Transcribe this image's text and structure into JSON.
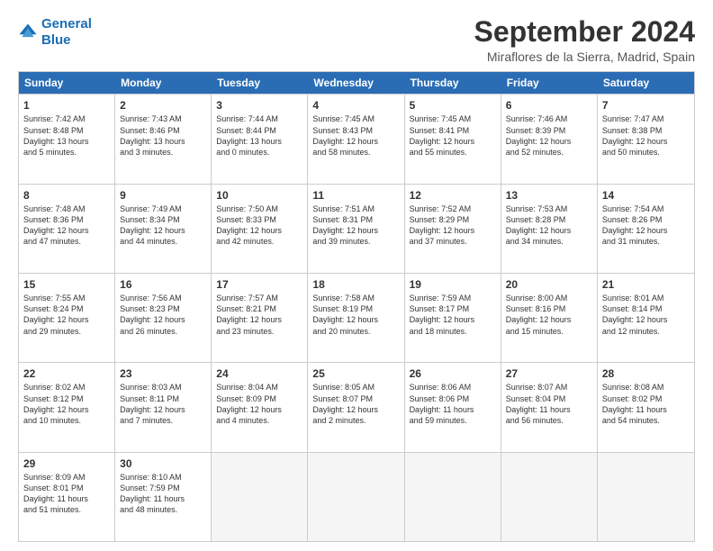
{
  "logo": {
    "line1": "General",
    "line2": "Blue"
  },
  "title": "September 2024",
  "location": "Miraflores de la Sierra, Madrid, Spain",
  "headers": [
    "Sunday",
    "Monday",
    "Tuesday",
    "Wednesday",
    "Thursday",
    "Friday",
    "Saturday"
  ],
  "rows": [
    [
      {
        "day": "1",
        "lines": [
          "Sunrise: 7:42 AM",
          "Sunset: 8:48 PM",
          "Daylight: 13 hours",
          "and 5 minutes."
        ]
      },
      {
        "day": "2",
        "lines": [
          "Sunrise: 7:43 AM",
          "Sunset: 8:46 PM",
          "Daylight: 13 hours",
          "and 3 minutes."
        ]
      },
      {
        "day": "3",
        "lines": [
          "Sunrise: 7:44 AM",
          "Sunset: 8:44 PM",
          "Daylight: 13 hours",
          "and 0 minutes."
        ]
      },
      {
        "day": "4",
        "lines": [
          "Sunrise: 7:45 AM",
          "Sunset: 8:43 PM",
          "Daylight: 12 hours",
          "and 58 minutes."
        ]
      },
      {
        "day": "5",
        "lines": [
          "Sunrise: 7:45 AM",
          "Sunset: 8:41 PM",
          "Daylight: 12 hours",
          "and 55 minutes."
        ]
      },
      {
        "day": "6",
        "lines": [
          "Sunrise: 7:46 AM",
          "Sunset: 8:39 PM",
          "Daylight: 12 hours",
          "and 52 minutes."
        ]
      },
      {
        "day": "7",
        "lines": [
          "Sunrise: 7:47 AM",
          "Sunset: 8:38 PM",
          "Daylight: 12 hours",
          "and 50 minutes."
        ]
      }
    ],
    [
      {
        "day": "8",
        "lines": [
          "Sunrise: 7:48 AM",
          "Sunset: 8:36 PM",
          "Daylight: 12 hours",
          "and 47 minutes."
        ]
      },
      {
        "day": "9",
        "lines": [
          "Sunrise: 7:49 AM",
          "Sunset: 8:34 PM",
          "Daylight: 12 hours",
          "and 44 minutes."
        ]
      },
      {
        "day": "10",
        "lines": [
          "Sunrise: 7:50 AM",
          "Sunset: 8:33 PM",
          "Daylight: 12 hours",
          "and 42 minutes."
        ]
      },
      {
        "day": "11",
        "lines": [
          "Sunrise: 7:51 AM",
          "Sunset: 8:31 PM",
          "Daylight: 12 hours",
          "and 39 minutes."
        ]
      },
      {
        "day": "12",
        "lines": [
          "Sunrise: 7:52 AM",
          "Sunset: 8:29 PM",
          "Daylight: 12 hours",
          "and 37 minutes."
        ]
      },
      {
        "day": "13",
        "lines": [
          "Sunrise: 7:53 AM",
          "Sunset: 8:28 PM",
          "Daylight: 12 hours",
          "and 34 minutes."
        ]
      },
      {
        "day": "14",
        "lines": [
          "Sunrise: 7:54 AM",
          "Sunset: 8:26 PM",
          "Daylight: 12 hours",
          "and 31 minutes."
        ]
      }
    ],
    [
      {
        "day": "15",
        "lines": [
          "Sunrise: 7:55 AM",
          "Sunset: 8:24 PM",
          "Daylight: 12 hours",
          "and 29 minutes."
        ]
      },
      {
        "day": "16",
        "lines": [
          "Sunrise: 7:56 AM",
          "Sunset: 8:23 PM",
          "Daylight: 12 hours",
          "and 26 minutes."
        ]
      },
      {
        "day": "17",
        "lines": [
          "Sunrise: 7:57 AM",
          "Sunset: 8:21 PM",
          "Daylight: 12 hours",
          "and 23 minutes."
        ]
      },
      {
        "day": "18",
        "lines": [
          "Sunrise: 7:58 AM",
          "Sunset: 8:19 PM",
          "Daylight: 12 hours",
          "and 20 minutes."
        ]
      },
      {
        "day": "19",
        "lines": [
          "Sunrise: 7:59 AM",
          "Sunset: 8:17 PM",
          "Daylight: 12 hours",
          "and 18 minutes."
        ]
      },
      {
        "day": "20",
        "lines": [
          "Sunrise: 8:00 AM",
          "Sunset: 8:16 PM",
          "Daylight: 12 hours",
          "and 15 minutes."
        ]
      },
      {
        "day": "21",
        "lines": [
          "Sunrise: 8:01 AM",
          "Sunset: 8:14 PM",
          "Daylight: 12 hours",
          "and 12 minutes."
        ]
      }
    ],
    [
      {
        "day": "22",
        "lines": [
          "Sunrise: 8:02 AM",
          "Sunset: 8:12 PM",
          "Daylight: 12 hours",
          "and 10 minutes."
        ]
      },
      {
        "day": "23",
        "lines": [
          "Sunrise: 8:03 AM",
          "Sunset: 8:11 PM",
          "Daylight: 12 hours",
          "and 7 minutes."
        ]
      },
      {
        "day": "24",
        "lines": [
          "Sunrise: 8:04 AM",
          "Sunset: 8:09 PM",
          "Daylight: 12 hours",
          "and 4 minutes."
        ]
      },
      {
        "day": "25",
        "lines": [
          "Sunrise: 8:05 AM",
          "Sunset: 8:07 PM",
          "Daylight: 12 hours",
          "and 2 minutes."
        ]
      },
      {
        "day": "26",
        "lines": [
          "Sunrise: 8:06 AM",
          "Sunset: 8:06 PM",
          "Daylight: 11 hours",
          "and 59 minutes."
        ]
      },
      {
        "day": "27",
        "lines": [
          "Sunrise: 8:07 AM",
          "Sunset: 8:04 PM",
          "Daylight: 11 hours",
          "and 56 minutes."
        ]
      },
      {
        "day": "28",
        "lines": [
          "Sunrise: 8:08 AM",
          "Sunset: 8:02 PM",
          "Daylight: 11 hours",
          "and 54 minutes."
        ]
      }
    ],
    [
      {
        "day": "29",
        "lines": [
          "Sunrise: 8:09 AM",
          "Sunset: 8:01 PM",
          "Daylight: 11 hours",
          "and 51 minutes."
        ]
      },
      {
        "day": "30",
        "lines": [
          "Sunrise: 8:10 AM",
          "Sunset: 7:59 PM",
          "Daylight: 11 hours",
          "and 48 minutes."
        ]
      },
      {
        "day": "",
        "lines": []
      },
      {
        "day": "",
        "lines": []
      },
      {
        "day": "",
        "lines": []
      },
      {
        "day": "",
        "lines": []
      },
      {
        "day": "",
        "lines": []
      }
    ]
  ]
}
